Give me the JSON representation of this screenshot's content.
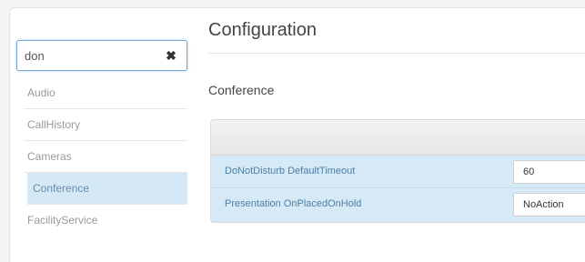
{
  "sidebar": {
    "search": {
      "value": "don",
      "clear_icon": "close-icon"
    },
    "items": [
      {
        "label": "Audio",
        "active": false
      },
      {
        "label": "CallHistory",
        "active": false
      },
      {
        "label": "Cameras",
        "active": false
      },
      {
        "label": "Conference",
        "active": true
      },
      {
        "label": "FacilityService",
        "active": false
      }
    ]
  },
  "main": {
    "title": "Configuration",
    "section_title": "Conference",
    "settings": [
      {
        "name": "DoNotDisturb DefaultTimeout",
        "value": "60"
      },
      {
        "name": "Presentation OnPlacedOnHold",
        "value": "NoAction"
      }
    ]
  },
  "colors": {
    "active_item_bg": "#d5e8f5",
    "row_bg": "#d6e9f6",
    "setting_name_text": "#4d7fa8"
  }
}
